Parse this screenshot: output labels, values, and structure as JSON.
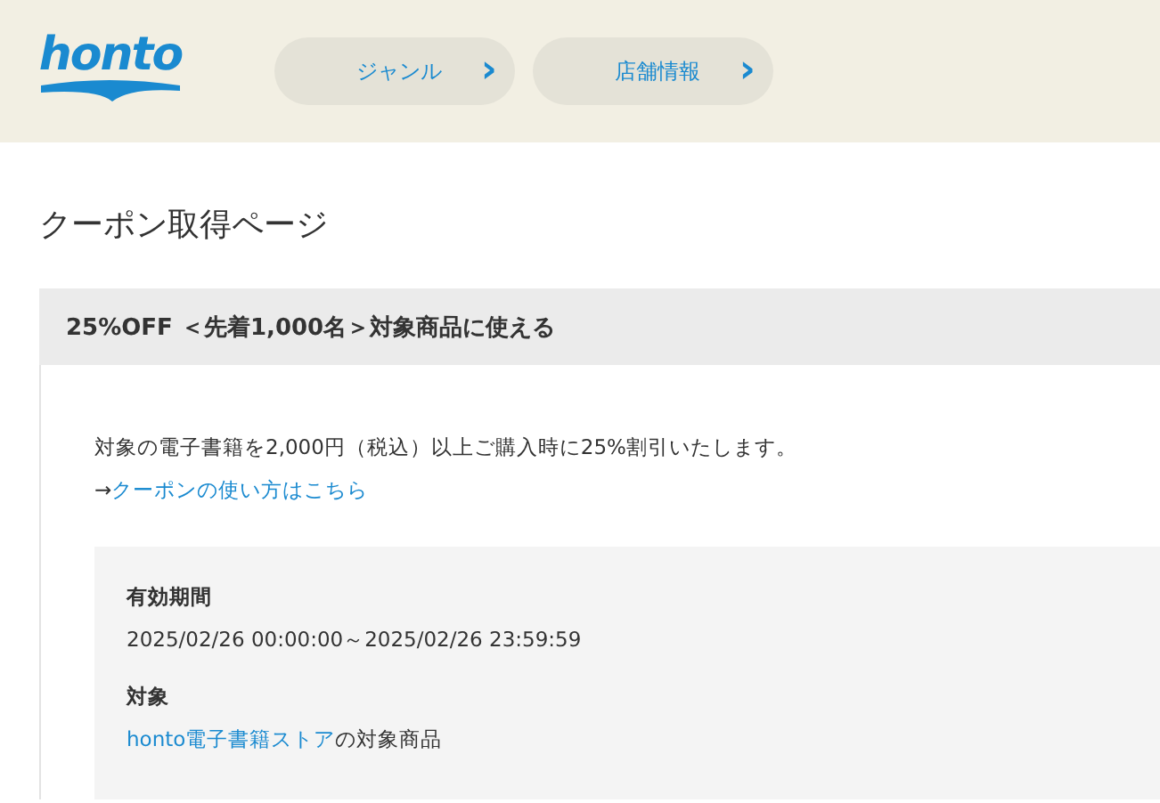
{
  "header": {
    "logo": "honto",
    "nav": [
      {
        "label": "ジャンル",
        "icon": "›"
      },
      {
        "label": "店舗情報",
        "icon": "›"
      }
    ]
  },
  "page_title": "クーポン取得ページ",
  "coupon": {
    "title": "25%OFF ＜先着1,000名＞対象商品に使える",
    "description": "対象の電子書籍を2,000円（税込）以上ご購入時に25%割引いたします。",
    "howto": {
      "arrow": "→",
      "link": "クーポンの使い方はこちら"
    },
    "details": [
      {
        "label": "有効期間",
        "value": "2025/02/26 00:00:00～2025/02/26 23:59:59"
      },
      {
        "label": "対象",
        "link": "honto電子書籍ストア",
        "value": "の対象商品"
      }
    ]
  }
}
